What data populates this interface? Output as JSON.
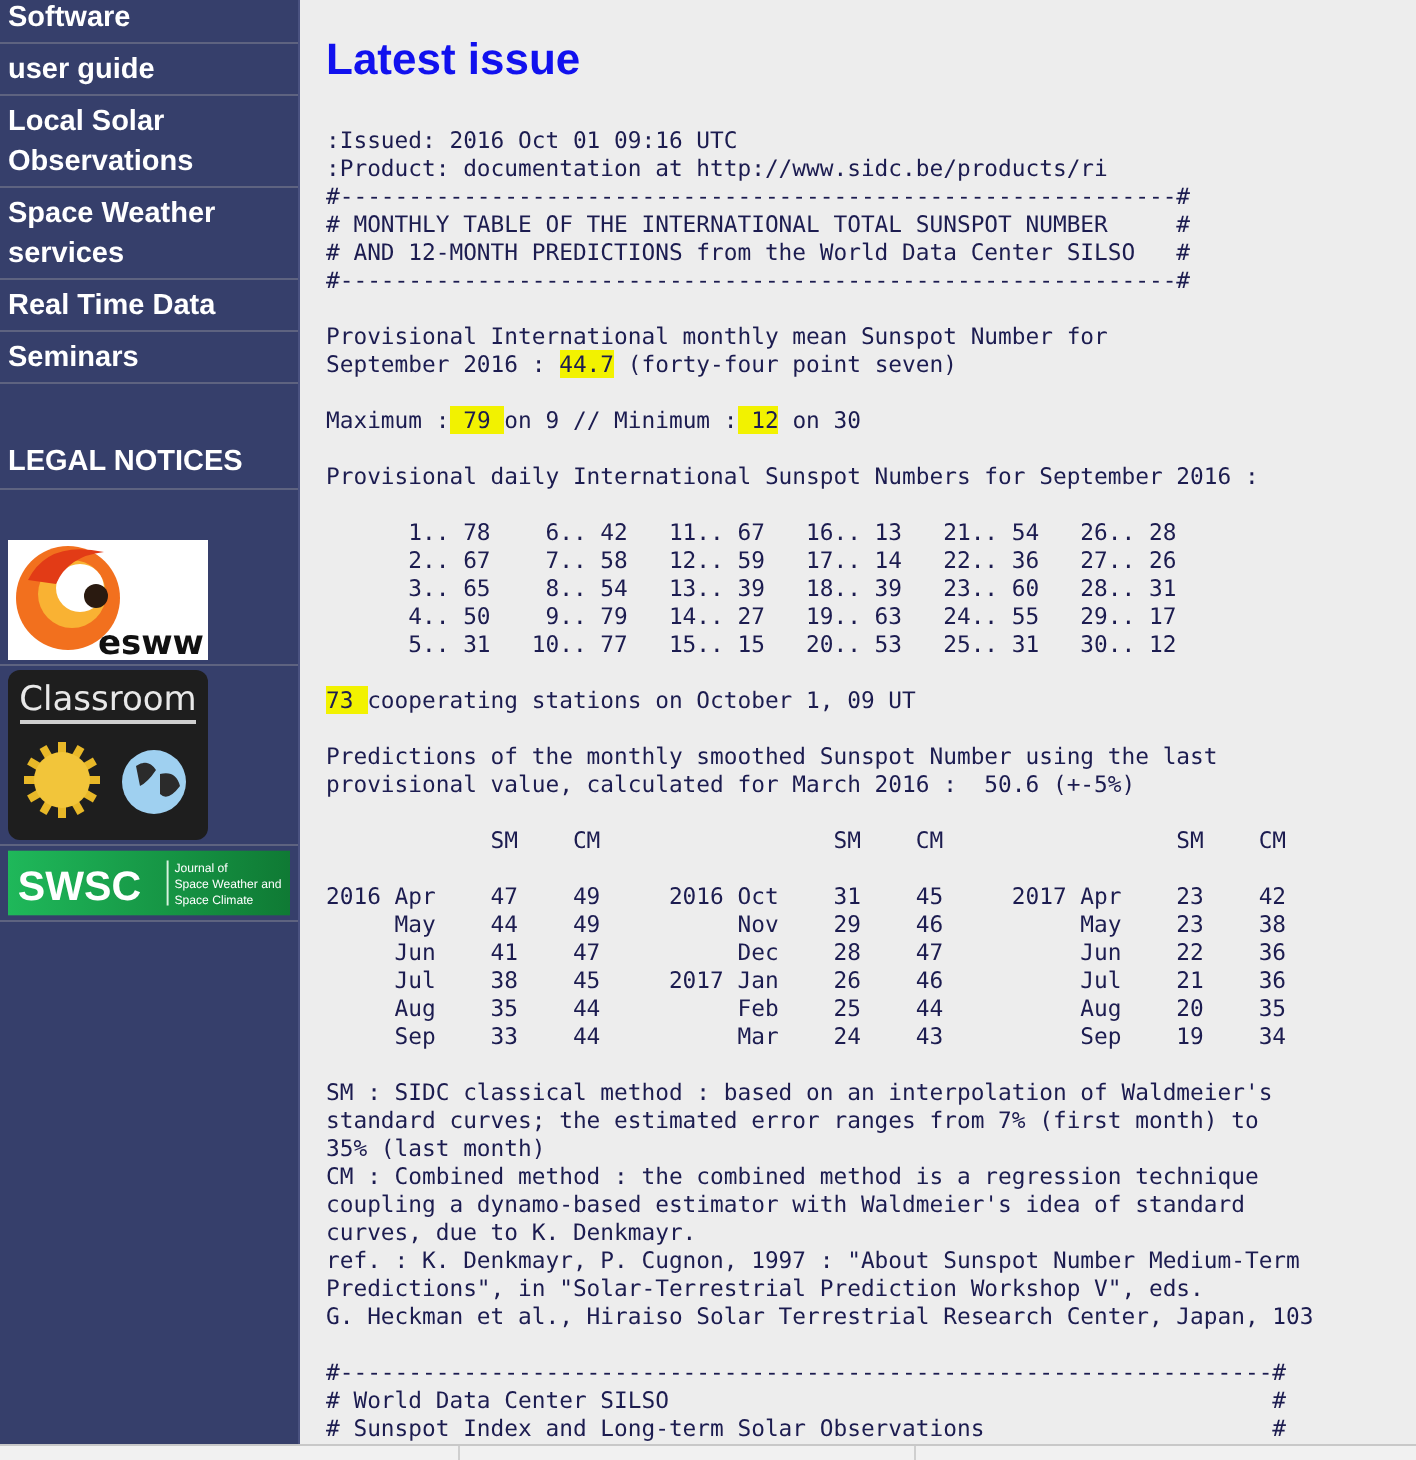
{
  "sidebar": {
    "items": [
      {
        "label": "Software"
      },
      {
        "label": "user guide"
      },
      {
        "label": "Local Solar Observations"
      },
      {
        "label": "Space Weather services"
      },
      {
        "label": "Real Time Data"
      },
      {
        "label": "Seminars"
      }
    ],
    "heading": "LEGAL NOTICES",
    "logos": [
      {
        "kind": "esww",
        "label": "esww"
      },
      {
        "kind": "classroom",
        "label": "Classroom"
      },
      {
        "kind": "swsc",
        "label": "SWSC",
        "caption": [
          "Journal of",
          "Space Weather and",
          "Space Climate"
        ]
      }
    ]
  },
  "title": "Latest issue",
  "report": {
    "blocks": [
      {
        "lines": [
          ":Issued: 2016 Oct 01 09:16 UTC",
          ":Product: documentation at http://www.sidc.be/products/ri",
          "#-------------------------------------------------------------#",
          "# MONTHLY TABLE OF THE INTERNATIONAL TOTAL SUNSPOT NUMBER     #",
          "# AND 12-MONTH PREDICTIONS from the World Data Center SILSO   #",
          "#-------------------------------------------------------------#"
        ]
      },
      {
        "lines": [
          "Provisional International monthly mean Sunspot Number for",
          [
            {
              "text": "September 2016 : ",
              "highlighted": false
            },
            {
              "text": "44.7",
              "highlighted": true
            },
            {
              "text": " (forty-four point seven)",
              "highlighted": false
            }
          ]
        ]
      },
      {
        "lines": [
          [
            {
              "text": "Maximum :",
              "highlighted": false
            },
            {
              "text": " 79 ",
              "highlighted": true
            },
            {
              "text": "on 9 // Minimum :",
              "highlighted": false
            },
            {
              "text": " 12",
              "highlighted": true
            },
            {
              "text": " on 30",
              "highlighted": false
            }
          ]
        ]
      },
      {
        "lines": [
          "Provisional daily International Sunspot Numbers for September 2016 :"
        ]
      },
      {
        "lines": [
          "      1.. 78    6.. 42   11.. 67   16.. 13   21.. 54   26.. 28",
          "      2.. 67    7.. 58   12.. 59   17.. 14   22.. 36   27.. 26",
          "      3.. 65    8.. 54   13.. 39   18.. 39   23.. 60   28.. 31",
          "      4.. 50    9.. 79   14.. 27   19.. 63   24.. 55   29.. 17",
          "      5.. 31   10.. 77   15.. 15   20.. 53   25.. 31   30.. 12"
        ]
      },
      {
        "lines": [
          [
            {
              "text": "73 ",
              "highlighted": true
            },
            {
              "text": "cooperating stations on October 1, 09 UT",
              "highlighted": false
            }
          ]
        ]
      },
      {
        "lines": [
          "Predictions of the monthly smoothed Sunspot Number using the last",
          "provisional value, calculated for March 2016 :  50.6 (+-5%)"
        ]
      },
      {
        "lines": [
          "            SM    CM                 SM    CM                 SM    CM"
        ]
      },
      {
        "lines": [
          "2016 Apr    47    49     2016 Oct    31    45     2017 Apr    23    42",
          "     May    44    49          Nov    29    46          May    23    38",
          "     Jun    41    47          Dec    28    47          Jun    22    36",
          "     Jul    38    45     2017 Jan    26    46          Jul    21    36",
          "     Aug    35    44          Feb    25    44          Aug    20    35",
          "     Sep    33    44          Mar    24    43          Sep    19    34"
        ]
      },
      {
        "lines": [
          "SM : SIDC classical method : based on an interpolation of Waldmeier's",
          "standard curves; the estimated error ranges from 7% (first month) to",
          "35% (last month)",
          "CM : Combined method : the combined method is a regression technique",
          "coupling a dynamo-based estimator with Waldmeier's idea of standard",
          "curves, due to K. Denkmayr.",
          "ref. : K. Denkmayr, P. Cugnon, 1997 : \"About Sunspot Number Medium-Term",
          "Predictions\", in \"Solar-Terrestrial Prediction Workshop V\", eds.",
          "G. Heckman et al., Hiraiso Solar Terrestrial Research Center, Japan, 103"
        ]
      },
      {
        "lines": [
          "#--------------------------------------------------------------------#",
          "# World Data Center SILSO                                            #",
          "# Sunspot Index and Long-term Solar Observations                     #"
        ]
      }
    ]
  }
}
